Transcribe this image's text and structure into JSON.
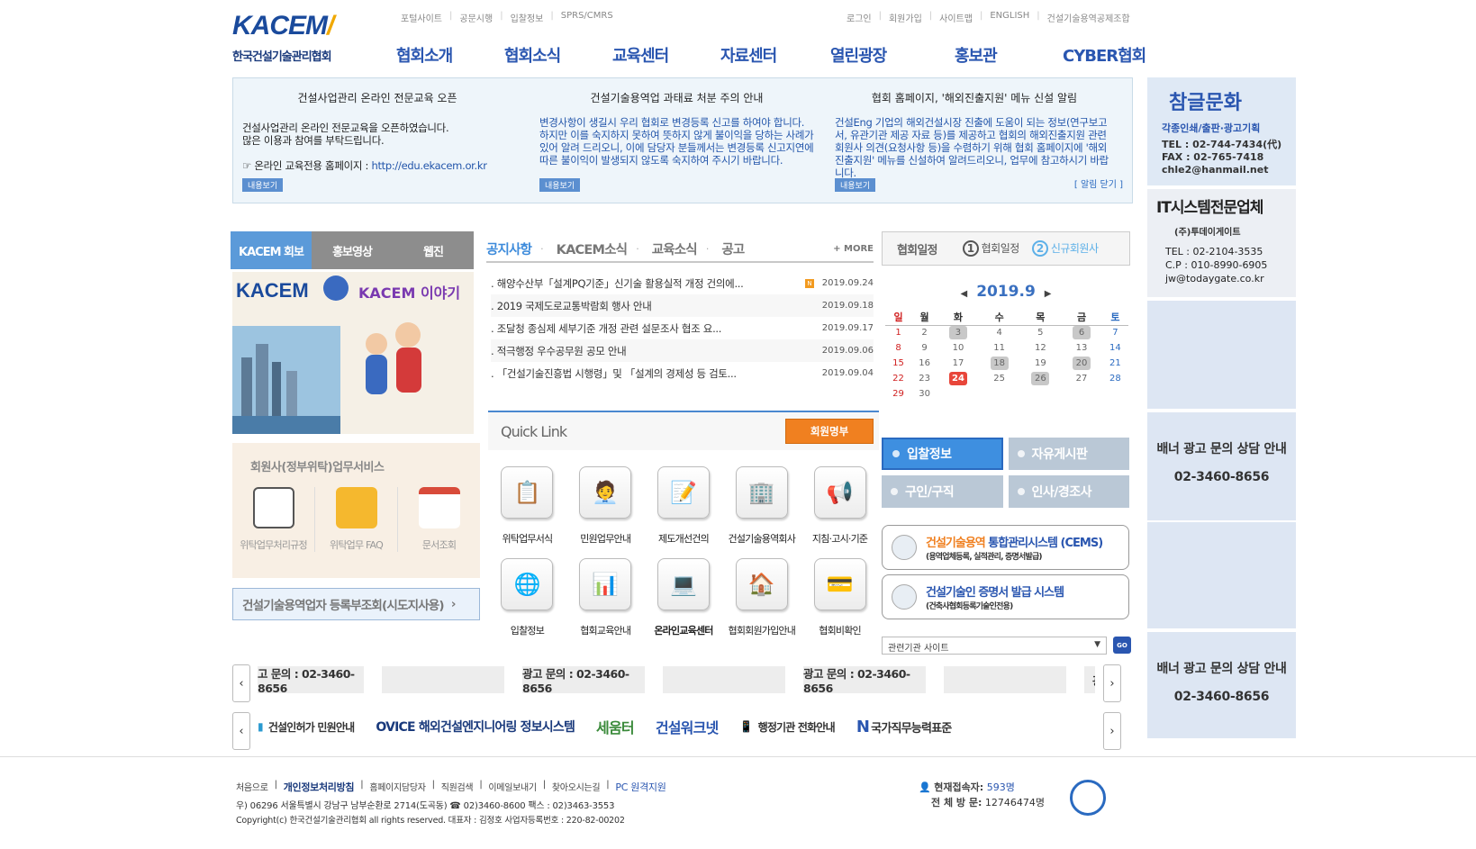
{
  "header": {
    "logo_en": "KACEM",
    "logo_ko": "한국건설기술관리협회",
    "util_left": [
      "포털사이트",
      "공문시행",
      "입찰정보",
      "SPRS/CMRS"
    ],
    "util_right": [
      "로그인",
      "회원가입",
      "사이트맵",
      "ENGLISH",
      "건설기술용역공제조합"
    ],
    "gnb": [
      "협회소개",
      "협회소식",
      "교육센터",
      "자료센터",
      "열린광장",
      "홍보관",
      "CYBER협회"
    ]
  },
  "band": {
    "n1": {
      "title": "건설사업관리 온라인 전문교육 오픈",
      "body1": "건설사업관리 온라인 전문교육을 오픈하였습니다.",
      "body2": "많은 이용과 참여를 부탁드립니다.",
      "body3": "☞ 온라인 교육전용 홈페이지 : ",
      "url": "http://edu.ekacem.or.kr",
      "more": "내용보기"
    },
    "n2": {
      "title": "건설기술용역업 과태료 처분 주의 안내",
      "body": "변경사항이 생길시 우리 협회로 변경등록 신고를 하여야 합니다. 하지만 이를 숙지하지 못하여 뜻하지 않게 불이익을 당하는 사례가 있어 알려 드리오니, 이에 담당자 분들께서는 변경등록 신고지연에 따른 불이익이 발생되지 않도록 숙지하여 주시기 바랍니다.",
      "more": "내용보기"
    },
    "n3": {
      "title": "협회 홈페이지, '해외진출지원' 메뉴 신설 알림",
      "body": "건설Eng 기업의 해외건설시장 진출에 도움이 되는 정보(연구보고서, 유관기관 제공 자료 등)를 제공하고 협회의 해외진출지원 관련 회원사 의견(요청사항 등)을 수렴하기 위해 협회 홈페이지에 '해외진출지원' 메뉴를 신설하여 알려드리오니, 업무에 참고하시기 바랍니다.",
      "more": "내용보기"
    },
    "close": "[ 알림 닫기 ]"
  },
  "left": {
    "tabs": [
      "KACEM 회보",
      "홍보영상",
      "웹진"
    ],
    "mag_title": "KACEM",
    "mag_sub": "KACEM 이야기",
    "svc_title": "회원사(정부위탁)업무서비스",
    "svc_items": [
      "위탁업무처리규정",
      "위탁업무 FAQ",
      "문서조회"
    ],
    "reg_btn": "건설기술용역업자 등록부조회(시도지사용)"
  },
  "notice": {
    "tabs": [
      "공지사항",
      "KACEM소식",
      "교육소식",
      "공고"
    ],
    "more": "+ MORE",
    "rows": [
      {
        "title": ". 해양수산부「설계PQ기준」신기술 활용실적 개정 건의에...",
        "date": "2019.09.24",
        "new": true
      },
      {
        "title": ". 2019 국제도로교통박람회 행사 안내",
        "date": "2019.09.18",
        "new": false
      },
      {
        "title": ". 조달청 종심제 세부기준 개정 관련 설문조사 협조 요...",
        "date": "2019.09.17",
        "new": false
      },
      {
        "title": ". 적극행정 우수공무원 공모 안내",
        "date": "2019.09.06",
        "new": false
      },
      {
        "title": ". 「건설기술진흥법 시행령」및 「설계의 경제성 등 검토...",
        "date": "2019.09.04",
        "new": false
      }
    ]
  },
  "quick": {
    "title": "Quick Link",
    "member_btn": "회원명부",
    "items": [
      "위탁업무서식",
      "민원업무안내",
      "제도개선건의",
      "건설기술용역회사",
      "지침·고시·기준",
      "입찰정보",
      "협회교육안내",
      "온라인교육센터",
      "협회회원가입안내",
      "협회비확인"
    ]
  },
  "schedule": {
    "tab1": "협회일정",
    "tab2": "협회일정",
    "tab3": "신규회원사",
    "n1": "1",
    "n2": "2",
    "month": "2019.9",
    "days": [
      "일",
      "월",
      "화",
      "수",
      "목",
      "금",
      "토"
    ],
    "weeks": [
      [
        "1",
        "2",
        "3",
        "4",
        "5",
        "6",
        "7"
      ],
      [
        "8",
        "9",
        "10",
        "11",
        "12",
        "13",
        "14"
      ],
      [
        "15",
        "16",
        "17",
        "18",
        "19",
        "20",
        "21"
      ],
      [
        "22",
        "23",
        "24",
        "25",
        "26",
        "27",
        "28"
      ],
      [
        "29",
        "30",
        "",
        "",
        "",
        "",
        ""
      ]
    ],
    "events": [
      "3",
      "6",
      "18",
      "20",
      "26"
    ],
    "today": "24"
  },
  "boards": [
    "입찰정보",
    "자유게시판",
    "구인/구직",
    "인사/경조사"
  ],
  "systems": {
    "cems_title1": "건설기술용역",
    "cems_title2": " 통합관리시스템 (CEMS)",
    "cems_sub": "(용역업체등록, 실적관리, 증명서발급)",
    "cert_title": "건설기술인 증명서 발급 시스템",
    "cert_sub": "(건축사협회등록기술인전용)"
  },
  "related": {
    "placeholder": "관련기관 사이트",
    "go": "GO"
  },
  "right": {
    "b1_name": "참글문화",
    "b1_desc": "각종인쇄/출판·광고기획",
    "b1_tel": "TEL : 02-744-7434(代)",
    "b1_fax": "FAX : 02-765-7418",
    "b1_mail": "chle2@hanmail.net",
    "b2_title": "IT시스템전문업체",
    "b2_company": "(주)투데이게이트",
    "b2_tel": "TEL : 02-2104-3535",
    "b2_cp": "C.P : 010-8990-6905",
    "b2_mail": "jw@todaygate.co.kr",
    "ad_line1": "배너 광고 문의 상담 안내",
    "ad_line2": "02-3460-8656"
  },
  "adroll": {
    "items": [
      "고 문의 : 02-3460-8656",
      "",
      "광고 문의 : 02-3460-8656",
      "",
      "광고 문의 : 02-3460-8656",
      "",
      "광고"
    ]
  },
  "logos": [
    "건설인허가 민원안내",
    "OVICE 해외건설엔지니어링 정보시스템",
    "세움터",
    "건설워크넷",
    "행정기관 전화안내",
    "국가직무능력표준"
  ],
  "footer": {
    "links": [
      "처음으로",
      "개인정보처리방침",
      "홈페이지담당자",
      "직원검색",
      "이메일보내기",
      "찾아오시는길",
      "PC 원격지원"
    ],
    "address": "우) 06296   서울특별시 강남구 남부순환로 2714(도곡동)   ☎ 02)3460-8600    팩스 : 02)3463-3553",
    "copyright": "Copyright(c) 한국건설기술관리협회 all rights reserved.  대표자 : 김정호  사업자등록번호 : 220-82-00202",
    "cur_label": "현재접속자:",
    "cur_val": "593명",
    "tot_label": "전 체 방 문:",
    "tot_val": "12746474명"
  },
  "colors": {
    "brand": "#2a56b0",
    "accent": "#3e8fe0",
    "orange": "#f08020"
  }
}
